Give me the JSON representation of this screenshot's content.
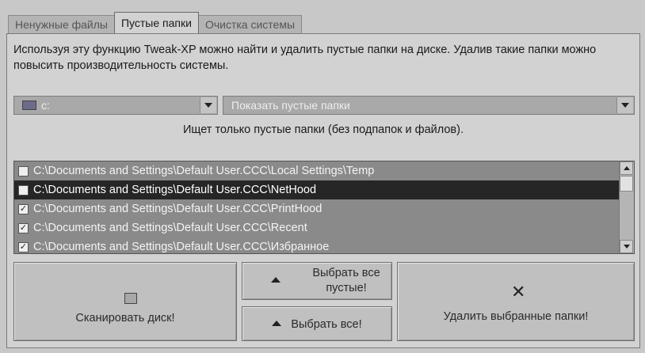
{
  "tabs": [
    {
      "label": "Ненужные файлы",
      "active": false
    },
    {
      "label": "Пустые папки",
      "active": true
    },
    {
      "label": "Очистка системы",
      "active": false
    }
  ],
  "description": "Используя эту функцию Tweak-XP можно найти и удалить пустые папки на диске. Удалив такие папки можно повысить производительность системы.",
  "drive_select": {
    "value": "c:",
    "icon": "drive-icon"
  },
  "mode_select": {
    "value": "Показать пустые папки"
  },
  "hint": "Ищет только пустые папки (без подпапок и файлов).",
  "folders": [
    {
      "path": "C:\\Documents and Settings\\Default User.CCC\\Local Settings\\Temp",
      "checked": false,
      "selected": false
    },
    {
      "path": "C:\\Documents and Settings\\Default User.CCC\\NetHood",
      "checked": false,
      "selected": true
    },
    {
      "path": "C:\\Documents and Settings\\Default User.CCC\\PrintHood",
      "checked": true,
      "selected": false
    },
    {
      "path": "C:\\Documents and Settings\\Default User.CCC\\Recent",
      "checked": true,
      "selected": false
    },
    {
      "path": "C:\\Documents and Settings\\Default User.CCC\\Избранное",
      "checked": true,
      "selected": false
    }
  ],
  "buttons": {
    "scan": "Сканировать диск!",
    "select_empty": "Выбрать все пустые!",
    "select_all": "Выбрать все!",
    "delete": "Удалить выбранные папки!"
  }
}
